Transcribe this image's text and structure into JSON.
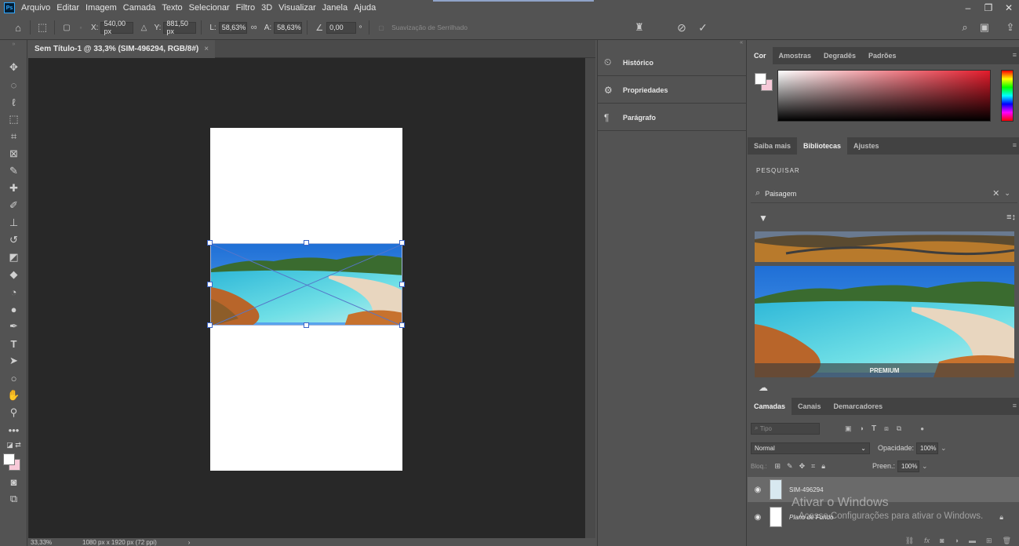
{
  "menu": {
    "logo": "Ps",
    "items": [
      "Arquivo",
      "Editar",
      "Imagem",
      "Camada",
      "Texto",
      "Selecionar",
      "Filtro",
      "3D",
      "Visualizar",
      "Janela",
      "Ajuda"
    ]
  },
  "options": {
    "x_label": "X:",
    "x_value": "540,00 px",
    "y_label": "Y:",
    "y_value": "881,50 px",
    "w_label": "L:",
    "w_value": "58,63%",
    "h_label": "A:",
    "h_value": "58,63%",
    "angle_value": "0,00",
    "angle_unit": "º",
    "smoothing": "Suavização de Serrilhado"
  },
  "document": {
    "tab_title": "Sem Título-1 @ 33,3% (SIM-496294, RGB/8#)",
    "zoom": "33,33%",
    "size_info": "1080 px x 1920 px (72 ppi)"
  },
  "mid_panel": {
    "items": [
      {
        "label": "Histórico",
        "icon": "history-icon"
      },
      {
        "label": "Propriedades",
        "icon": "properties-icon"
      },
      {
        "label": "Parágrafo",
        "icon": "paragraph-icon"
      }
    ]
  },
  "color_panel": {
    "tabs": [
      "Cor",
      "Amostras",
      "Degradês",
      "Padrões"
    ],
    "foreground": "#ffffff",
    "background": "#f7c9d8",
    "hue_color": "#e31b2b"
  },
  "libraries_panel": {
    "tabs": [
      "Saiba mais",
      "Bibliotecas",
      "Ajustes"
    ],
    "search_label": "PESQUISAR",
    "search_value": "Paisagem",
    "premium_badge": "PREMIUM"
  },
  "layers_panel": {
    "tabs": [
      "Camadas",
      "Canais",
      "Demarcadores"
    ],
    "filter_placeholder": "Tipo",
    "blend_mode": "Normal",
    "opacity_label": "Opacidade:",
    "opacity_value": "100%",
    "lock_label": "Bloq.:",
    "fill_label": "Preen.:",
    "fill_value": "100%",
    "layers": [
      {
        "name": "SIM-496294",
        "selected": true
      },
      {
        "name": "Plano de Fundo",
        "selected": false
      }
    ]
  },
  "watermark": {
    "title": "Ativar o Windows",
    "subtitle": "Acesse Configurações para ativar o Windows."
  }
}
